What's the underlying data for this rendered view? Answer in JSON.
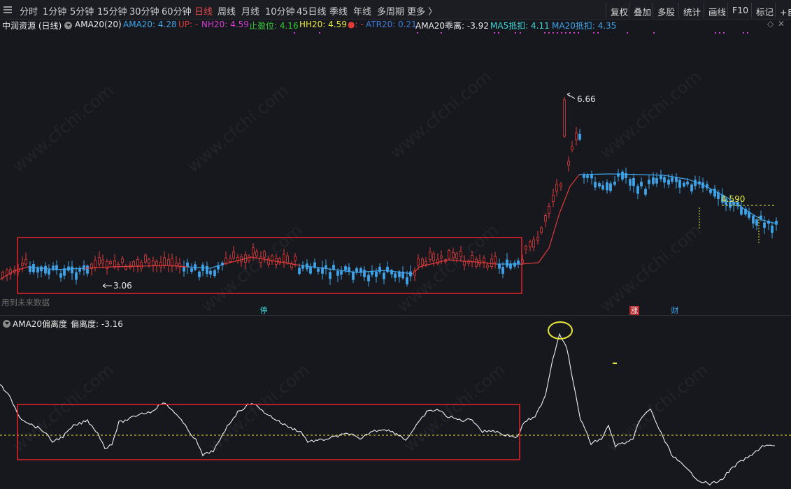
{
  "toolbar": {
    "periods": [
      "分时",
      "1分钟",
      "5分钟",
      "15分钟",
      "30分钟",
      "60分钟",
      "日线",
      "周线",
      "月线",
      "10分钟",
      "45日线",
      "季线",
      "年线",
      "多周期",
      "更多 〉"
    ],
    "active_period": "日线",
    "right_tools": [
      "复权",
      "叠加",
      "多股",
      "统计",
      "画线",
      "F10",
      "标记",
      "+自"
    ]
  },
  "legend": {
    "stock_name": "中润资源 (日线)",
    "indicator_name": "AMA20(20)",
    "ama20": "AMA20: 4.28",
    "up": "UP: -",
    "nh20": "NH20: 4.59",
    "stop_profit": "止盈位: 4.16",
    "hh20": "HH20: 4.59",
    "dot_label": "●: -",
    "atr20": "ATR20: 0.21",
    "ama20_deviation": "AMA20乖离: -3.92",
    "ma5_deduct": "MA5抵扣: 4.11",
    "ma20_deduct": "MA20抵扣: 4.35"
  },
  "main_chart": {
    "high_label": "6.66",
    "low_label": "3.06",
    "level_label": "4.590",
    "future_data_note": "用到未来数据",
    "events": {
      "stop": "停",
      "rise": "涨",
      "finance": "财"
    }
  },
  "indicator": {
    "title": "AMA20偏离度",
    "value": "偏离度: -3.16"
  },
  "watermark": "www.cfchi.com",
  "colors": {
    "up": "#e03a3a",
    "down": "#3ea3e8",
    "ama_up": "#e03a3a",
    "ama_down": "#3ea3e8",
    "highlight_box": "#e0242c",
    "yellow": "#e6e63c",
    "magenta": "#d13cd1"
  }
}
